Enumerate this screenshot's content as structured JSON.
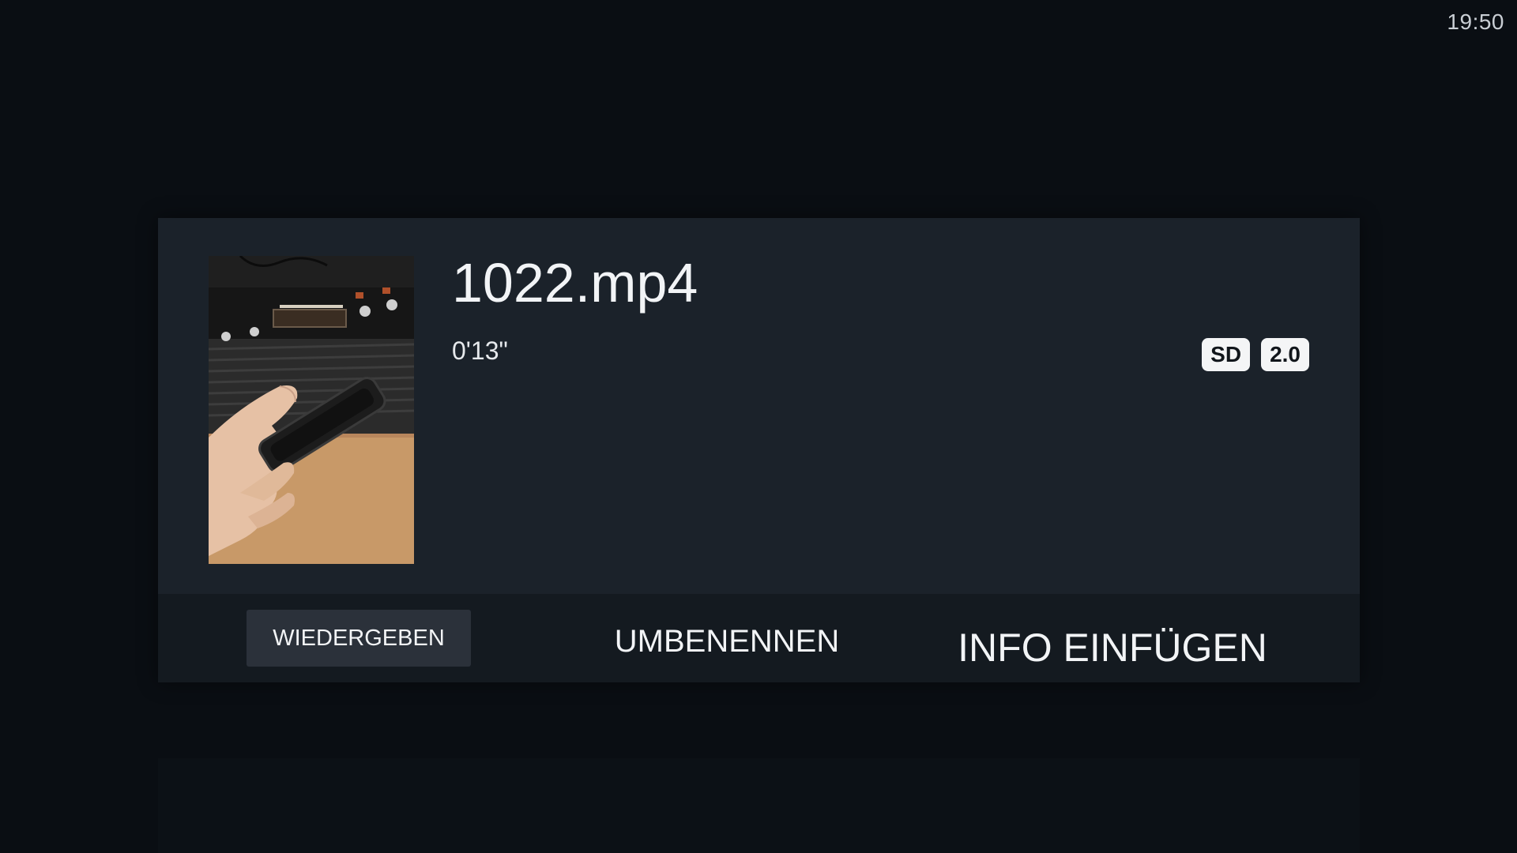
{
  "status_bar": {
    "clock": "19:50"
  },
  "media": {
    "title": "1022.mp4",
    "duration": "0'13\"",
    "thumbnail_icon": "video-thumbnail-retro-console",
    "badges": [
      "SD",
      "2.0"
    ]
  },
  "actions": {
    "play_label": "WIEDERGEBEN",
    "rename_label": "UMBENENNEN",
    "info_label": "INFO EINFÜGEN"
  },
  "colors": {
    "background": "#0a0e13",
    "dialog": "#1b222a",
    "action_bar": "#141a20",
    "focused_button": "#2b313a",
    "badge": "#f4f5f6"
  }
}
